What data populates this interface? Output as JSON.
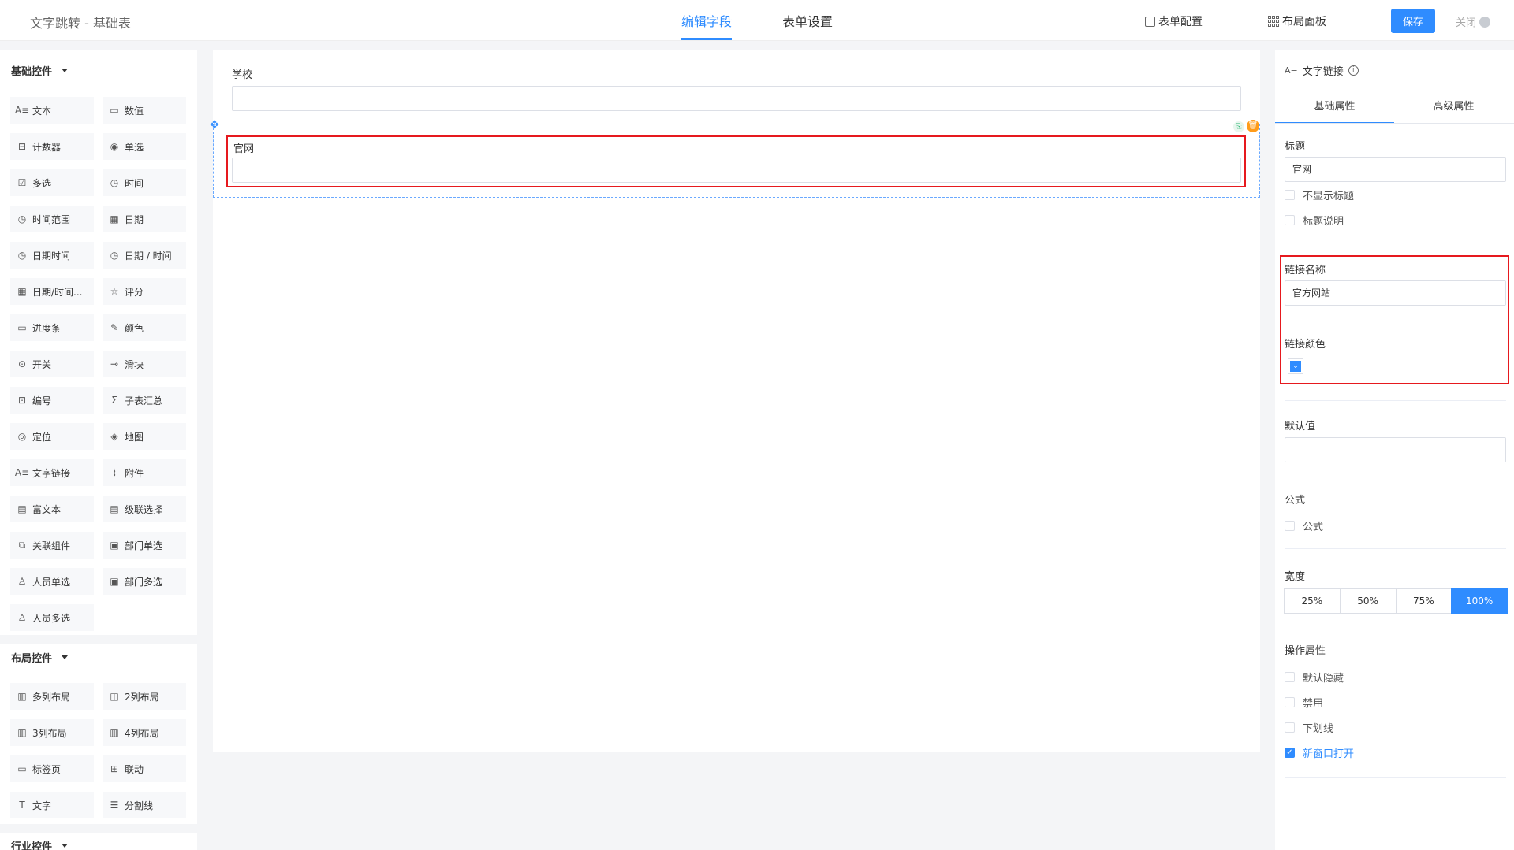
{
  "header": {
    "app_title": "文字跳转 - 基础表",
    "tabs": [
      {
        "label": "编辑字段"
      },
      {
        "label": "表单设置"
      }
    ],
    "form_config": "表单配置",
    "layout_panel": "布局面板",
    "save": "保存",
    "close": "关闭"
  },
  "sidebar": {
    "basic_title": "基础控件",
    "basic_items": [
      {
        "label": "文本",
        "icon": "A≡"
      },
      {
        "label": "数值",
        "icon": "▭"
      },
      {
        "label": "计数器",
        "icon": "⊟"
      },
      {
        "label": "单选",
        "icon": "◉"
      },
      {
        "label": "多选",
        "icon": "☑"
      },
      {
        "label": "时间",
        "icon": "◷"
      },
      {
        "label": "时间范围",
        "icon": "◷"
      },
      {
        "label": "日期",
        "icon": "▦"
      },
      {
        "label": "日期时间",
        "icon": "◷"
      },
      {
        "label": "日期 / 时间",
        "icon": "◷"
      },
      {
        "label": "日期/时间...",
        "icon": "▦"
      },
      {
        "label": "评分",
        "icon": "☆"
      },
      {
        "label": "进度条",
        "icon": "▭"
      },
      {
        "label": "颜色",
        "icon": "✎"
      },
      {
        "label": "开关",
        "icon": "⊙"
      },
      {
        "label": "滑块",
        "icon": "⊸"
      },
      {
        "label": "编号",
        "icon": "⊡"
      },
      {
        "label": "子表汇总",
        "icon": "Σ"
      },
      {
        "label": "定位",
        "icon": "◎"
      },
      {
        "label": "地图",
        "icon": "◈"
      },
      {
        "label": "文字链接",
        "icon": "A≡"
      },
      {
        "label": "附件",
        "icon": "⌇"
      },
      {
        "label": "富文本",
        "icon": "▤"
      },
      {
        "label": "级联选择",
        "icon": "▤"
      },
      {
        "label": "关联组件",
        "icon": "⧉"
      },
      {
        "label": "部门单选",
        "icon": "▣"
      },
      {
        "label": "人员单选",
        "icon": "♙"
      },
      {
        "label": "部门多选",
        "icon": "▣"
      },
      {
        "label": "人员多选",
        "icon": "♙"
      }
    ],
    "layout_title": "布局控件",
    "layout_items": [
      {
        "label": "多列布局",
        "icon": "▥"
      },
      {
        "label": "2列布局",
        "icon": "◫"
      },
      {
        "label": "3列布局",
        "icon": "▥"
      },
      {
        "label": "4列布局",
        "icon": "▥"
      },
      {
        "label": "标签页",
        "icon": "▭"
      },
      {
        "label": "联动",
        "icon": "⊞"
      },
      {
        "label": "文字",
        "icon": "T"
      },
      {
        "label": "分割线",
        "icon": "☰"
      }
    ],
    "industry_title": "行业控件"
  },
  "canvas": {
    "field1_label": "学校",
    "field2_label": "官网"
  },
  "panel": {
    "title": "文字链接",
    "tabs": [
      {
        "label": "基础属性"
      },
      {
        "label": "高级属性"
      }
    ],
    "title_label": "标题",
    "title_value": "官网",
    "hide_title": "不显示标题",
    "title_desc": "标题说明",
    "link_name_label": "链接名称",
    "link_name_value": "官方网站",
    "link_color_label": "链接颜色",
    "link_color": "#2f8cff",
    "default_label": "默认值",
    "formula_label": "公式",
    "formula_check": "公式",
    "width_label": "宽度",
    "widths": [
      "25%",
      "50%",
      "75%",
      "100%"
    ],
    "width_selected": "100%",
    "ops_label": "操作属性",
    "ops": [
      {
        "label": "默认隐藏",
        "checked": false
      },
      {
        "label": "禁用",
        "checked": false
      },
      {
        "label": "下划线",
        "checked": false
      },
      {
        "label": "新窗口打开",
        "checked": true
      }
    ]
  },
  "colors": {
    "accent": "#2f8cff",
    "highlight": "#e6191e",
    "delete": "#ff9c1a"
  }
}
